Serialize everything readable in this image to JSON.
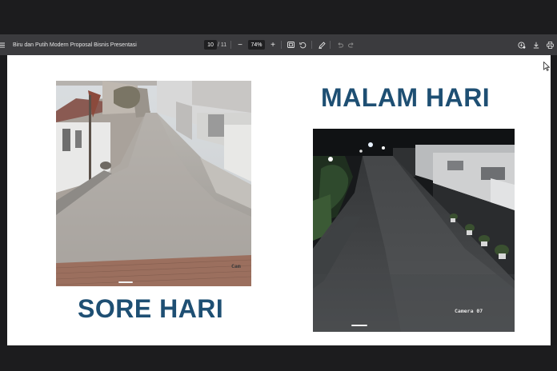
{
  "toolbar": {
    "document_title": "Biru dan Putih Modern Proposal Bisnis Presentasi",
    "current_page": "10",
    "page_separator": "/ 11",
    "zoom_level": "74%",
    "zoom_out_label": "−",
    "zoom_in_label": "+"
  },
  "slide": {
    "heading_day": "SORE HARI",
    "heading_night": "MALAM HARI",
    "day_camera_label": "Cam",
    "night_camera_label": "Camera 07",
    "heading_color": "#1e4f73"
  },
  "icons": [
    "menu-icon",
    "fit-page-icon",
    "rotate-icon",
    "draw-icon",
    "undo-icon",
    "redo-icon",
    "save-copy-icon",
    "download-icon",
    "print-icon",
    "cursor-icon"
  ]
}
